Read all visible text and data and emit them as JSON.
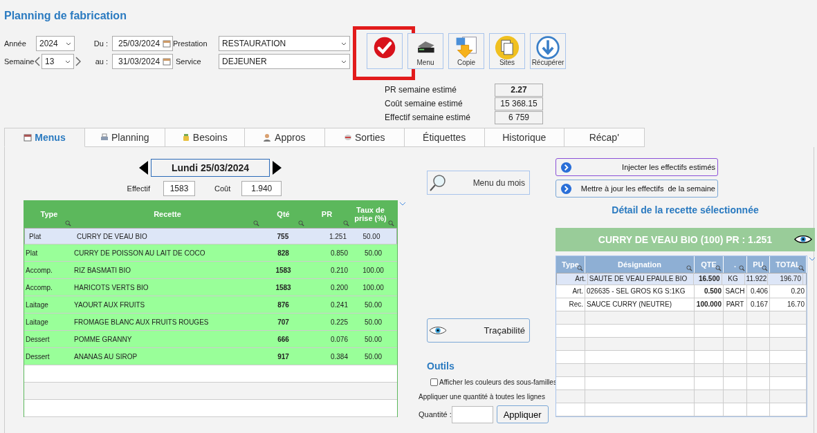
{
  "title": "Planning de fabrication",
  "filters": {
    "annee": {
      "label": "Année",
      "value": "2024"
    },
    "semaine": {
      "label": "Semaine",
      "value": "13"
    },
    "du": {
      "label": "Du :",
      "value": "25/03/2024"
    },
    "au": {
      "label": "au :",
      "value": "31/03/2024"
    },
    "prestation": {
      "label": "Prestation",
      "value": "RESTAURATION"
    },
    "service": {
      "label": "Service",
      "value": "DEJEUNER"
    }
  },
  "toolbar": [
    {
      "kind": "validate",
      "highlighted": true
    },
    {
      "kind": "print",
      "label": "Menu",
      "highlighted": false
    },
    {
      "kind": "copy",
      "label": "Copie",
      "highlighted": false
    },
    {
      "kind": "sites",
      "label": "Sites",
      "highlighted": false
    },
    {
      "kind": "download",
      "label": "Récupérer",
      "highlighted": false
    }
  ],
  "stats": [
    {
      "label": "PR semaine estimé",
      "value": "2.27",
      "emphasis": true
    },
    {
      "label": "Coût semaine estimé",
      "value": "15 368.15",
      "emphasis": false
    },
    {
      "label": "Effectif semaine estimé",
      "value": "6 759",
      "emphasis": false
    }
  ],
  "tabs": [
    {
      "label": "Menus",
      "selected": true
    },
    {
      "label": "Planning",
      "selected": false
    },
    {
      "label": "Besoins",
      "selected": false
    },
    {
      "label": "Appros",
      "selected": false
    },
    {
      "label": "Sorties",
      "selected": false
    },
    {
      "label": "Étiquettes",
      "selected": false
    },
    {
      "label": "Historique",
      "selected": false
    },
    {
      "label": "Récap'",
      "selected": false
    }
  ],
  "day": {
    "label": "Lundi 25/03/2024"
  },
  "effectif": {
    "label": "Effectif",
    "value": "1583"
  },
  "cout": {
    "label": "Coût",
    "value": "1.940"
  },
  "menu_table": {
    "columns": [
      "Type",
      "Recette",
      "Qté",
      "PR",
      "Taux de prise (%)"
    ],
    "rows": [
      {
        "type": "Plat",
        "recette": "CURRY DE VEAU BIO",
        "qte": "755",
        "pr": "1.251",
        "taux": "50.00",
        "selected": true
      },
      {
        "type": "Plat",
        "recette": "CURRY DE POISSON AU LAIT DE COCO",
        "qte": "828",
        "pr": "0.850",
        "taux": "50.00",
        "selected": false
      },
      {
        "type": "Accomp.",
        "recette": "RIZ BASMATI BIO",
        "qte": "1583",
        "pr": "0.210",
        "taux": "100.00",
        "selected": false
      },
      {
        "type": "Accomp.",
        "recette": "HARICOTS VERTS BIO",
        "qte": "1583",
        "pr": "0.200",
        "taux": "100.00",
        "selected": false
      },
      {
        "type": "Laitage",
        "recette": "YAOURT AUX FRUITS",
        "qte": "876",
        "pr": "0.241",
        "taux": "50.00",
        "selected": false
      },
      {
        "type": "Laitage",
        "recette": "FROMAGE BLANC AUX FRUITS ROUGES",
        "qte": "707",
        "pr": "0.225",
        "taux": "50.00",
        "selected": false
      },
      {
        "type": "Dessert",
        "recette": "POMME GRANNY",
        "qte": "666",
        "pr": "0.076",
        "taux": "50.00",
        "selected": false
      },
      {
        "type": "Dessert",
        "recette": "ANANAS AU SIROP",
        "qte": "917",
        "pr": "0.384",
        "taux": "50.00",
        "selected": false
      }
    ]
  },
  "menu_du_mois": {
    "label": "Menu du mois"
  },
  "tracabilite": {
    "label": "Traçabilité"
  },
  "outils": {
    "heading": "Outils",
    "checkbox": {
      "label": "Afficher les couleurs des sous-familles",
      "checked": false
    },
    "hint": "Appliquer une quantité à toutes les lignes",
    "quantity": {
      "label": "Quantité :"
    },
    "apply": "Appliquer"
  },
  "actions": [
    {
      "label": "Injecter les effectifs estimés",
      "focused": true
    },
    {
      "label": "Mettre à jour les effectifs  de la semaine",
      "focused": false
    }
  ],
  "detail": {
    "heading": "Détail de la recette sélectionnée",
    "banner": "CURRY DE VEAU BIO (100) PR : 1.251",
    "columns": [
      "Type",
      "Désignation",
      "QTE",
      ".",
      "PU",
      "TOTAL"
    ],
    "rows": [
      {
        "type": "Art.",
        "designation": "SAUTE DE VEAU EPAULE BIO",
        "qte": "16.500",
        "unite": "KG",
        "pu": "11.922",
        "total": "196.70",
        "selected": true
      },
      {
        "type": "Art.",
        "designation": "026635 - SEL GROS KG S:1KG",
        "qte": "0.500",
        "unite": "SACH",
        "pu": "0.406",
        "total": "0.20",
        "selected": false
      },
      {
        "type": "Rec.",
        "designation": "SAUCE CURRY (NEUTRE)",
        "qte": "100.000",
        "unite": "PART",
        "pu": "0.167",
        "total": "16.70",
        "selected": false
      }
    ]
  }
}
